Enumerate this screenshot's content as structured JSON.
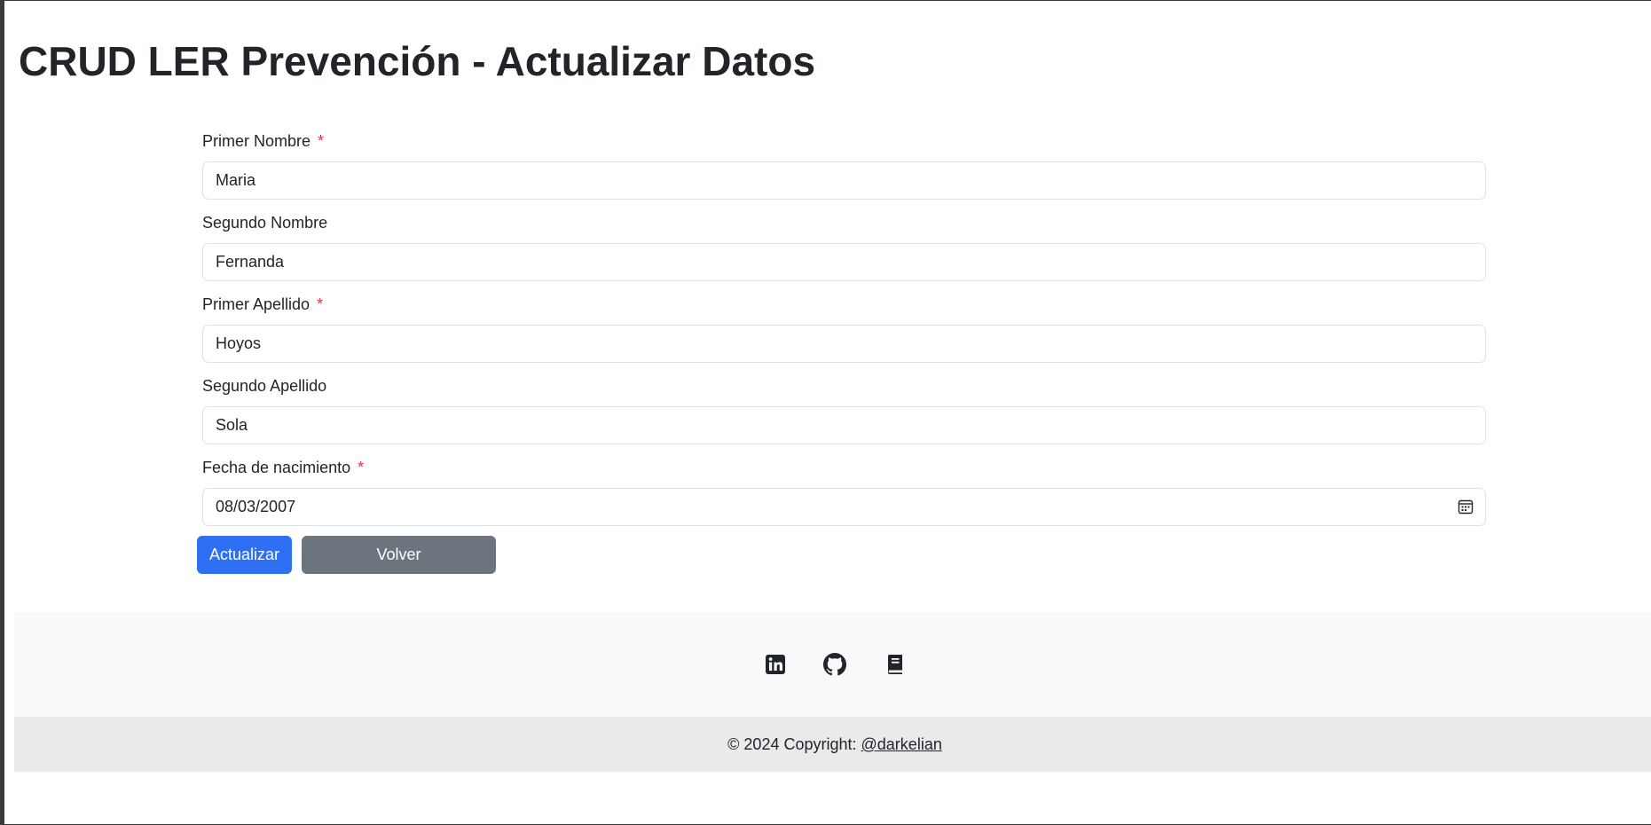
{
  "page": {
    "title": "CRUD LER Prevención - Actualizar Datos"
  },
  "form": {
    "required_marker": "*",
    "fields": [
      {
        "label": "Primer Nombre",
        "value": "Maria",
        "required": true
      },
      {
        "label": "Segundo Nombre",
        "value": "Fernanda",
        "required": false
      },
      {
        "label": "Primer Apellido",
        "value": "Hoyos",
        "required": true
      },
      {
        "label": "Segundo Apellido",
        "value": "Sola",
        "required": false
      },
      {
        "label": "Fecha de nacimiento",
        "value": "08/03/2007",
        "required": true,
        "icon": "calendar-icon"
      }
    ],
    "update_label": "Actualizar",
    "back_label": "Volver"
  },
  "footer": {
    "icons": [
      "linkedin-icon",
      "github-icon",
      "book-icon"
    ],
    "copyright_text": "© 2024 Copyright: ",
    "copyright_link": "@darkelian"
  },
  "colors": {
    "primary": "#2f6ff6",
    "secondary": "#6c757d",
    "required": "#dc3545",
    "footer_bg": "#f8f9fa",
    "copyright_bg": "#e9eaeb"
  }
}
